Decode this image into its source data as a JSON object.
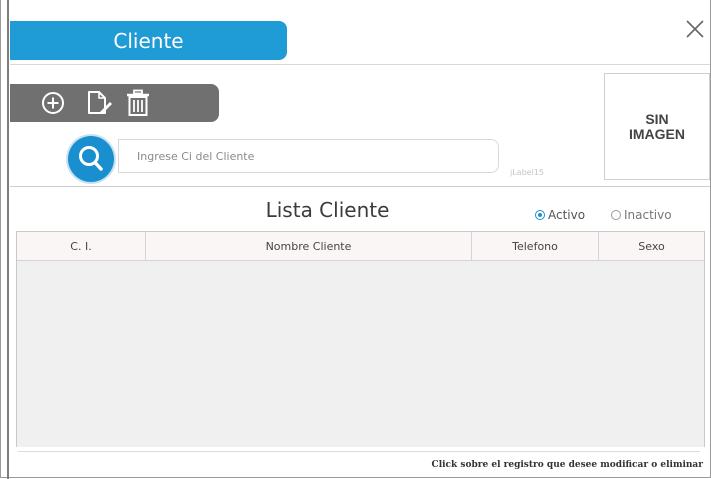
{
  "window": {
    "title": "Cliente",
    "close_icon": "close-icon"
  },
  "toolbar": {
    "icons": [
      "add-circle-icon",
      "edit-document-icon",
      "trash-icon"
    ]
  },
  "photo": {
    "line1": "SIN",
    "line2": "IMAGEN"
  },
  "search": {
    "placeholder": "Ingrese Ci del Cliente",
    "value": "",
    "icon": "search-icon",
    "hidden_label": "jLabel15"
  },
  "list": {
    "title": "Lista Cliente",
    "filters": [
      {
        "label": "Activo",
        "selected": true
      },
      {
        "label": "Inactivo",
        "selected": false
      }
    ],
    "columns": [
      "C. I.",
      "Nombre Cliente",
      "Telefono",
      "Sexo"
    ],
    "rows": []
  },
  "footer": {
    "hint": "Click  sobre el registro que desee modificar o eliminar"
  },
  "colors": {
    "accent": "#1f9bd6",
    "toolbar": "#707070",
    "search_button": "#1a8fcf"
  }
}
